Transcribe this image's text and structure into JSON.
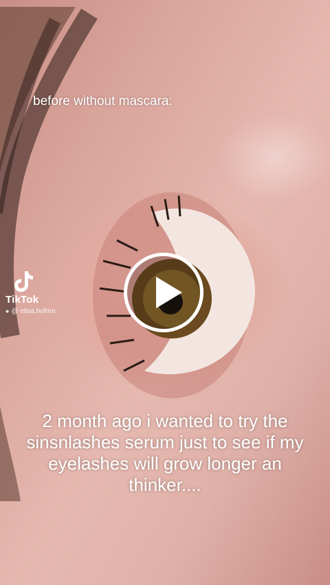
{
  "video": {
    "caption_top": "before without mascara:",
    "caption_bottom": "2 month ago i wanted to try the sinsnlashes serum just to see if my eyelashes will grow longer an thinker....",
    "play_icon": "play-icon"
  },
  "watermark": {
    "brand": "TikTok",
    "username": "@ elisa.hofmn",
    "logo_icon": "tiktok-logo-icon",
    "user_icon": "person-icon"
  },
  "colors": {
    "skin": "#e2aaa0",
    "iris": "#6b4a1f",
    "text": "#ffffff"
  }
}
